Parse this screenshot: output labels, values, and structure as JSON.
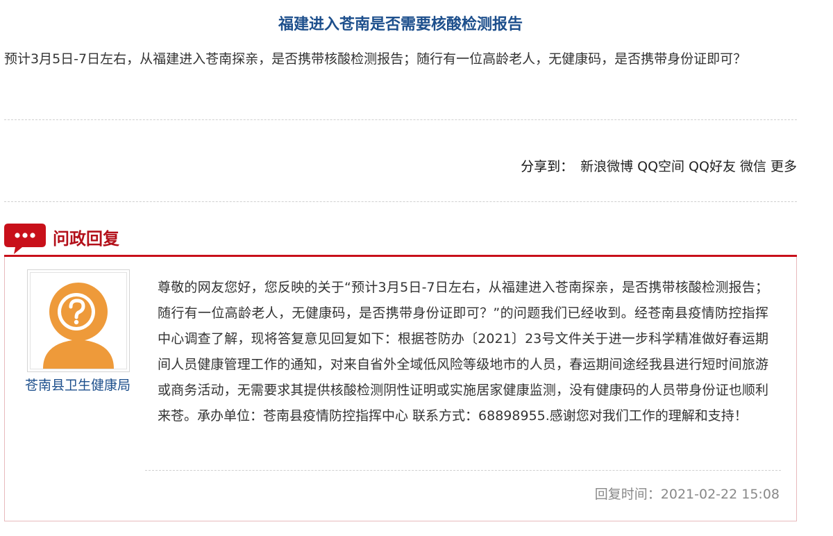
{
  "page_title": "福建进入苍南是否需要核酸检测报告",
  "question_text": "预计3月5日-7日左右，从福建进入苍南探亲，是否携带核酸检测报告；随行有一位高龄老人，无健康码，是否携带身份证即可？",
  "share": {
    "label": "分享到：",
    "links": [
      "新浪微博",
      "QQ空间",
      "QQ好友",
      "微信",
      "更多"
    ]
  },
  "reply_section": {
    "title": "问政回复",
    "icon": "chat-bubble-icon",
    "department": "苍南县卫生健康局",
    "avatar_icon": "question-person-icon",
    "answer": "尊敬的网友您好，您反映的关于“预计3月5日-7日左右，从福建进入苍南探亲，是否携带核酸检测报告；随行有一位高龄老人，无健康码，是否携带身份证即可？”的问题我们已经收到。经苍南县疫情防控指挥中心调查了解，现将答复意见回复如下：根据苍防办〔2021〕23号文件关于进一步科学精准做好春运期间人员健康管理工作的通知，对来自省外全域低风险等级地市的人员，春运期间途经我县进行短时间旅游或商务活动，无需要求其提供核酸检测阴性证明或实施居家健康监测，没有健康码的人员带身份证也顺利来苍。承办单位：苍南县疫情防控指挥中心 联系方式：68898955.感谢您对我们工作的理解和支持！",
    "reply_time": "回复时间：2021-02-22 15:08"
  },
  "colors": {
    "title_blue": "#1d4f8c",
    "accent_red": "#c8101a",
    "avatar_orange": "#ee9a3a"
  }
}
